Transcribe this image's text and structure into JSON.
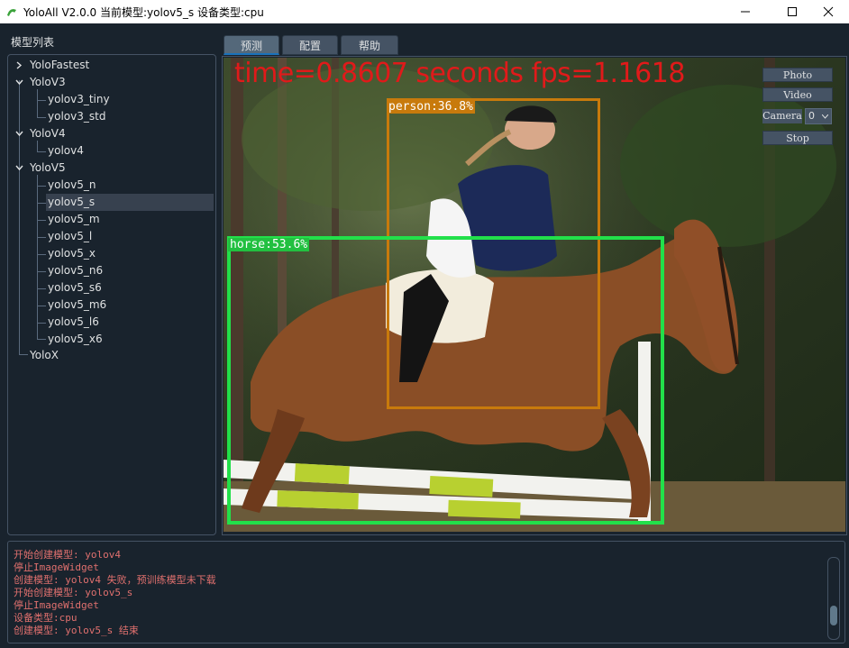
{
  "window": {
    "title": "YoloAll V2.0.0 当前模型:yolov5_s 设备类型:cpu",
    "minimize_icon": "minimize-icon",
    "maximize_icon": "maximize-icon",
    "close_icon": "close-icon"
  },
  "model_panel": {
    "title": "模型列表",
    "tree": [
      {
        "label": "YoloFastest",
        "expanded": false
      },
      {
        "label": "YoloV3",
        "expanded": true,
        "children": [
          "yolov3_tiny",
          "yolov3_std"
        ]
      },
      {
        "label": "YoloV4",
        "expanded": true,
        "children": [
          "yolov4"
        ]
      },
      {
        "label": "YoloV5",
        "expanded": true,
        "children": [
          "yolov5_n",
          "yolov5_s",
          "yolov5_m",
          "yolov5_l",
          "yolov5_x",
          "yolov5_n6",
          "yolov5_s6",
          "yolov5_m6",
          "yolov5_l6",
          "yolov5_x6"
        ]
      },
      {
        "label": "YoloX"
      }
    ],
    "selected": "yolov5_s"
  },
  "tabs": [
    {
      "label": "预测",
      "active": true
    },
    {
      "label": "配置",
      "active": false
    },
    {
      "label": "帮助",
      "active": false
    }
  ],
  "prediction": {
    "overlay_text": "time=0.8607 seconds fps=1.1618",
    "detections": [
      {
        "label": "person:36.8%",
        "color": "#c87a0c"
      },
      {
        "label": "horse:53.6%",
        "color": "#22e04a"
      }
    ],
    "controls": {
      "photo": "Photo",
      "video": "Video",
      "camera_label": "Camera",
      "camera_value": "0",
      "stop": "Stop"
    }
  },
  "log": {
    "lines": [
      "开始创建模型: yolov4",
      "停止ImageWidget",
      "创建模型: yolov4 失败，预训练模型未下载",
      "开始创建模型: yolov5_s",
      "停止ImageWidget",
      "设备类型:cpu",
      "创建模型: yolov5_s 结束"
    ],
    "color": "#e0706e"
  },
  "colors": {
    "background": "#19232d",
    "accent": "#1a72bb",
    "overlay_red": "#e01a1a"
  }
}
